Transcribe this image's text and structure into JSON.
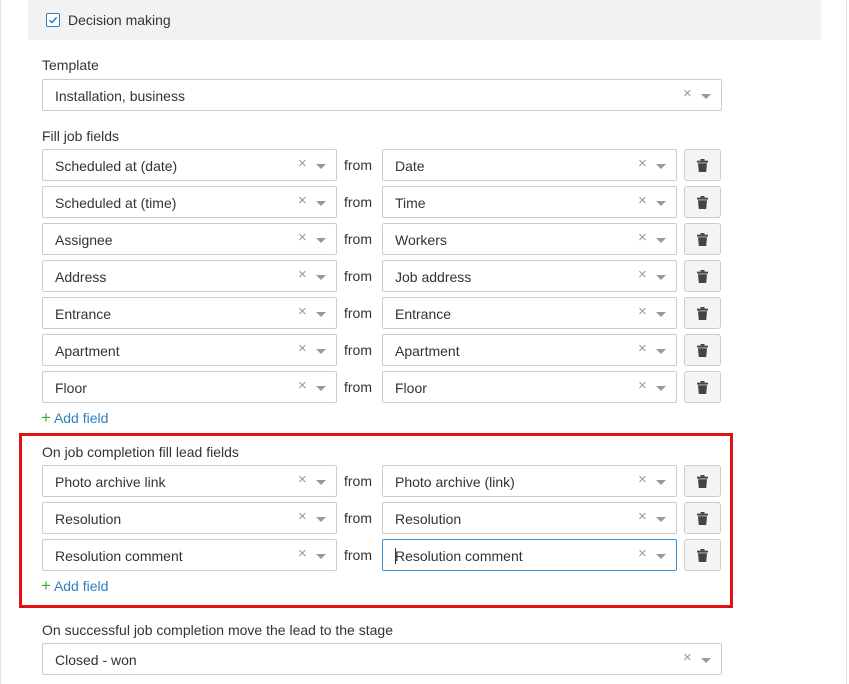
{
  "decision": {
    "checked": true,
    "label": "Decision making"
  },
  "template": {
    "label": "Template",
    "value": "Installation, business"
  },
  "fill_job_fields": {
    "label": "Fill job fields",
    "rows": [
      {
        "field": "Scheduled at (date)",
        "from": "from",
        "source": "Date"
      },
      {
        "field": "Scheduled at (time)",
        "from": "from",
        "source": "Time"
      },
      {
        "field": "Assignee",
        "from": "from",
        "source": "Workers"
      },
      {
        "field": "Address",
        "from": "from",
        "source": "Job address"
      },
      {
        "field": "Entrance",
        "from": "from",
        "source": "Entrance"
      },
      {
        "field": "Apartment",
        "from": "from",
        "source": "Apartment"
      },
      {
        "field": "Floor",
        "from": "from",
        "source": "Floor"
      }
    ],
    "add_label": "Add field"
  },
  "lead_fields": {
    "label": "On job completion fill lead fields",
    "rows": [
      {
        "field": "Photo archive link",
        "from": "from",
        "source": "Photo archive (link)"
      },
      {
        "field": "Resolution",
        "from": "from",
        "source": "Resolution"
      },
      {
        "field": "Resolution comment",
        "from": "from",
        "source": "Resolution comment"
      }
    ],
    "add_label": "Add field"
  },
  "stage": {
    "label": "On successful job completion move the lead to the stage",
    "value": "Closed - won"
  },
  "icons": {
    "clear": "×",
    "clear_icon": "close-icon",
    "caret_icon": "chevron-down-icon",
    "trash_icon": "trash-icon",
    "check_icon": "check-icon",
    "plus_icon": "plus-icon"
  },
  "colors": {
    "accent": "#2d7fbd",
    "add_plus": "#3ba53b",
    "highlight": "#e01010",
    "focus_border": "#3a8fd0"
  }
}
